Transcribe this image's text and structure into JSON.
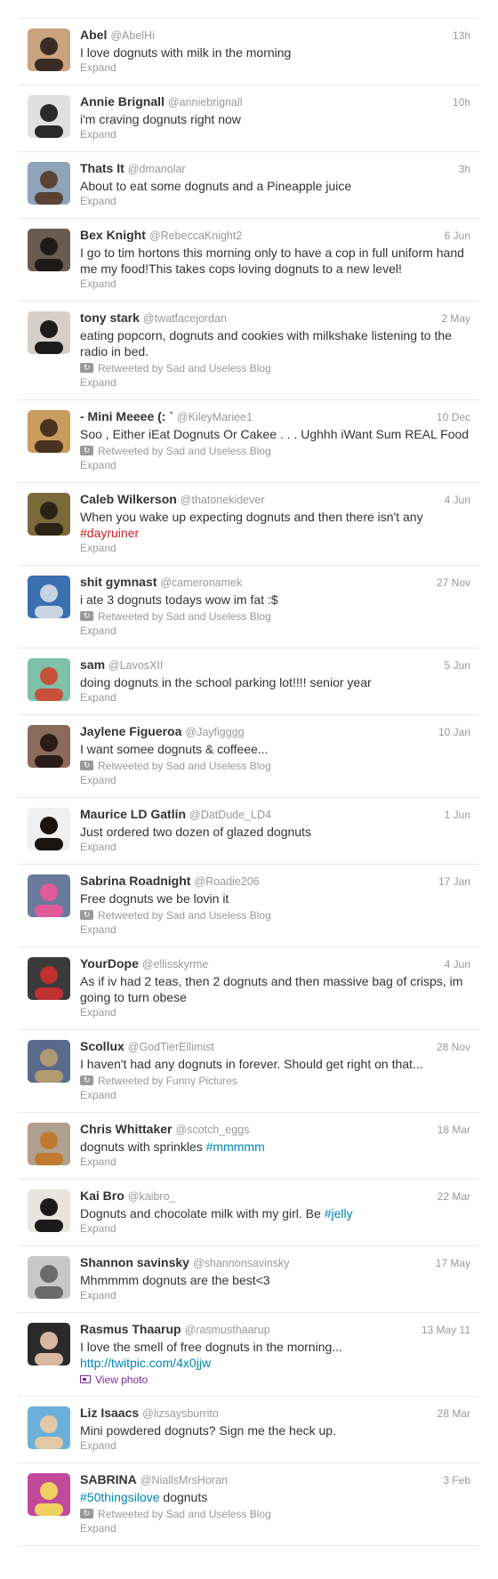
{
  "tweets": [
    {
      "name": "Abel",
      "handle": "@AbelHi",
      "time": "13h",
      "text": [
        {
          "t": "I love dognuts with milk in the morning"
        }
      ],
      "expand": "Expand",
      "av": [
        "#c9a27e",
        "#3a2b24"
      ]
    },
    {
      "name": "Annie Brignall",
      "handle": "@anniebrignall",
      "time": "10h",
      "text": [
        {
          "t": "i'm craving dognuts right now"
        }
      ],
      "expand": "Expand",
      "av": [
        "#e0e0e0",
        "#2a2a2a"
      ]
    },
    {
      "name": "Thats It",
      "handle": "@dmanolar",
      "time": "3h",
      "text": [
        {
          "t": "About to eat some dognuts and a Pineapple juice"
        }
      ],
      "expand": "Expand",
      "av": [
        "#8fa4b8",
        "#5b4233"
      ]
    },
    {
      "name": "Bex Knight",
      "handle": "@RebeccaKnight2",
      "time": "6 Jun",
      "text": [
        {
          "t": "I go to tim hortons this morning only to have a cop in full uniform hand me my food!This takes cops loving dognuts to a new level!"
        }
      ],
      "expand": "Expand",
      "av": [
        "#6b5b4f",
        "#1f1a17"
      ]
    },
    {
      "name": "tony stark",
      "handle": "@twatfacejordan",
      "time": "2 May",
      "text": [
        {
          "t": "eating popcorn, dognuts and cookies with milkshake listening to the radio in bed."
        }
      ],
      "context": "Retweeted by Sad and Useless Blog",
      "expand": "Expand",
      "av": [
        "#d8cfc8",
        "#1c1c1c"
      ]
    },
    {
      "name": "- Mini Meeee (: `",
      "handle": "@KileyMariee1",
      "time": "10 Dec",
      "text": [
        {
          "t": "Soo , Either iEat Dognuts Or Cakee . . . Ughhh iWant Sum REAL Food"
        }
      ],
      "context": "Retweeted by Sad and Useless Blog",
      "expand": "Expand",
      "av": [
        "#c79c5c",
        "#4a3220"
      ]
    },
    {
      "name": "Caleb Wilkerson",
      "handle": "@thatonekidever",
      "time": "4 Jun",
      "text": [
        {
          "t": "When you wake up expecting dognuts and then there isn't any "
        },
        {
          "t": "#dayruiner",
          "c": "hashtag red"
        }
      ],
      "expand": "Expand",
      "av": [
        "#7a6a3a",
        "#2b2416"
      ]
    },
    {
      "name": "shit gymnast",
      "handle": "@cameronamek",
      "time": "27 Nov",
      "text": [
        {
          "t": "i ate 3 dognuts todays wow im fat :$"
        }
      ],
      "context": "Retweeted by Sad and Useless Blog",
      "expand": "Expand",
      "av": [
        "#3a6fb0",
        "#c8d4e0"
      ]
    },
    {
      "name": "sam",
      "handle": "@LavosXII",
      "time": "5 Jun",
      "text": [
        {
          "t": "doing dognuts in the school parking lot!!!! senior year"
        }
      ],
      "expand": "Expand",
      "av": [
        "#7fc0a8",
        "#c8503a"
      ]
    },
    {
      "name": "Jaylene Figueroa",
      "handle": "@Jayfigggg",
      "time": "10 Jan",
      "text": [
        {
          "t": "I want somee dognuts & coffeee..."
        }
      ],
      "context": "Retweeted by Sad and Useless Blog",
      "expand": "Expand",
      "av": [
        "#8a6a5a",
        "#2a1c18"
      ]
    },
    {
      "name": "Maurice LD Gatlin",
      "handle": "@DatDude_LD4",
      "time": "1 Jun",
      "text": [
        {
          "t": "Just ordered two dozen of glazed dognuts"
        }
      ],
      "expand": "Expand",
      "av": [
        "#f0f0f0",
        "#1a1410"
      ]
    },
    {
      "name": "Sabrina Roadnight",
      "handle": "@Roadie206",
      "time": "17 Jan",
      "text": [
        {
          "t": "Free dognuts we be lovin it"
        }
      ],
      "context": "Retweeted by Sad and Useless Blog",
      "expand": "Expand",
      "av": [
        "#6a7a9a",
        "#e05a9a"
      ]
    },
    {
      "name": "YourDope",
      "handle": "@ellisskyrme",
      "time": "4 Jun",
      "text": [
        {
          "t": "As if iv had 2 teas, then 2 dognuts and then massive bag of crisps, im going to turn obese"
        }
      ],
      "expand": "Expand",
      "av": [
        "#3a3a3a",
        "#c03030"
      ]
    },
    {
      "name": "Scollux",
      "handle": "@GodTierEllimist",
      "time": "28 Nov",
      "text": [
        {
          "t": "I haven't had any dognuts in forever. Should get right on that..."
        }
      ],
      "context": "Retweeted by Funny Pictures",
      "expand": "Expand",
      "av": [
        "#5a6a8a",
        "#b09a70"
      ]
    },
    {
      "name": "Chris Whittaker",
      "handle": "@scotch_eggs",
      "time": "18 Mar",
      "text": [
        {
          "t": "dognuts with sprinkles "
        },
        {
          "t": "#mmmmm",
          "c": "hashtag"
        }
      ],
      "expand": "Expand",
      "av": [
        "#b0a090",
        "#c07a30"
      ]
    },
    {
      "name": "Kai Bro",
      "handle": "@kaibro_",
      "time": "22 Mar",
      "text": [
        {
          "t": "Dognuts and chocolate milk with my girl. Be "
        },
        {
          "t": "#jelly",
          "c": "hashtag"
        }
      ],
      "expand": "Expand",
      "av": [
        "#e8e4e0",
        "#1a1a1a"
      ]
    },
    {
      "name": "Shannon savinsky",
      "handle": "@shannonsavinsky",
      "time": "17 May",
      "text": [
        {
          "t": "Mhmmmm dognuts are the best<3"
        }
      ],
      "expand": "Expand",
      "av": [
        "#c8c8c8",
        "#6a6a6a"
      ]
    },
    {
      "name": "Rasmus Thaarup",
      "handle": "@rasmusthaarup",
      "time": "13 May 11",
      "text": [
        {
          "t": "I love the smell of free dognuts in the morning..."
        }
      ],
      "link": "http://twitpic.com/4x0jjw",
      "photo": "View photo",
      "av": [
        "#2a2a2a",
        "#d9b8a0"
      ]
    },
    {
      "name": "Liz Isaacs",
      "handle": "@lizsaysburrito",
      "time": "28 Mar",
      "text": [
        {
          "t": "Mini powdered dognuts? Sign me the heck up."
        }
      ],
      "expand": "Expand",
      "av": [
        "#6ab0d8",
        "#e0c8a8"
      ]
    },
    {
      "name": "SABRINA",
      "handle": "@NiallsMrsHoran",
      "time": "3 Feb",
      "text": [
        {
          "t": "#50thingsilove",
          "c": "hashtag"
        },
        {
          "t": " dognuts"
        }
      ],
      "context": "Retweeted by Sad and Useless Blog",
      "expand": "Expand",
      "av": [
        "#c04a9a",
        "#f0d060"
      ]
    }
  ]
}
